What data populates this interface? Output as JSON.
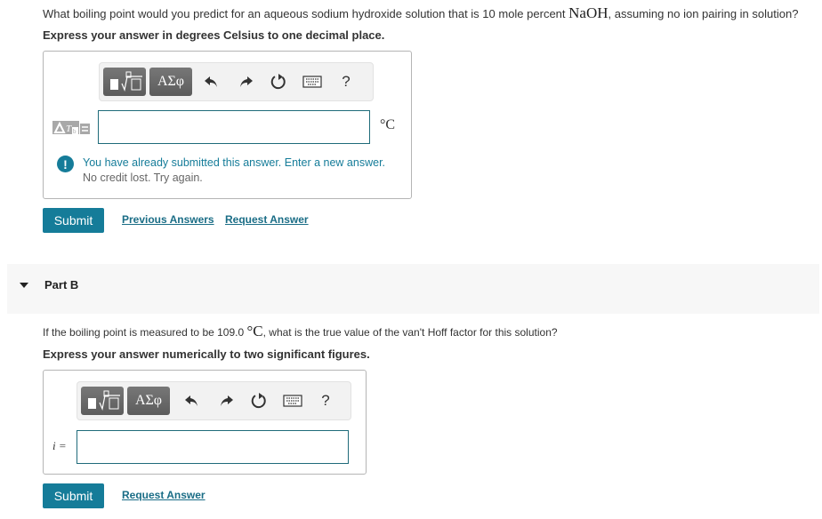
{
  "part_a": {
    "question_prefix": "What boiling point would you predict for an aqueous sodium hydroxide solution that is 10 mole percent ",
    "question_formula": "NaOH",
    "question_suffix": ", assuming no ion pairing in solution?",
    "instruction": "Express your answer in degrees Celsius to one decimal place.",
    "toolbar": {
      "templates_label": "templates",
      "greek_label": "ΑΣφ",
      "undo_icon": "undo-icon",
      "redo_icon": "redo-icon",
      "reset_icon": "reset-icon",
      "keyboard_icon": "keyboard-icon",
      "help_label": "?"
    },
    "input_label_image": "ΔT_b =",
    "input_value": "",
    "unit": "°C",
    "feedback": {
      "icon": "exclamation-icon",
      "message": "You have already submitted this answer. Enter a new answer.",
      "submessage": "No credit lost. Try again."
    },
    "submit_label": "Submit",
    "previous_answers_label": "Previous Answers",
    "request_answer_label": "Request Answer"
  },
  "part_b": {
    "header_label": "Part B",
    "toggle_icon": "caret-down-icon",
    "question_prefix": "If the boiling point is measured to be 109.0 ",
    "question_unit": "°C",
    "question_suffix": ", what is the true value of the van't Hoff factor for this solution?",
    "instruction": "Express your answer numerically to two significant figures.",
    "toolbar": {
      "greek_label": "ΑΣφ",
      "help_label": "?"
    },
    "input_label": "i =",
    "input_value": "",
    "submit_label": "Submit",
    "request_answer_label": "Request Answer"
  },
  "colors": {
    "accent": "#157c99",
    "link": "#1a6d86",
    "input_border": "#1f6b7a",
    "part_bar_bg": "#f7f7f7"
  }
}
